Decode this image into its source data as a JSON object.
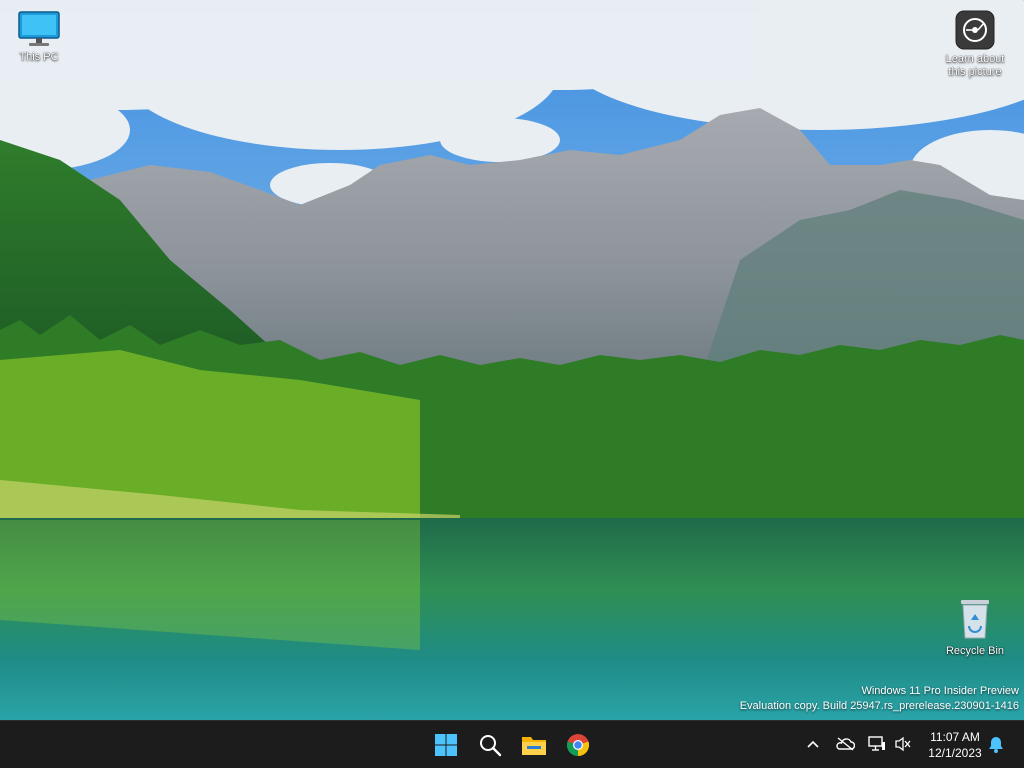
{
  "desktop": {
    "wallpaper": "mountain-lake-forest",
    "icons": {
      "this_pc": {
        "label": "This PC",
        "icon": "monitor-icon"
      },
      "learn": {
        "label_line1": "Learn about",
        "label_line2": "this picture",
        "icon": "camera-info-icon"
      },
      "recycle_bin": {
        "label": "Recycle Bin",
        "icon": "recycle-bin-icon"
      }
    },
    "watermark": {
      "line1": "Windows 11 Pro Insider Preview",
      "line2": "Evaluation copy. Build 25947.rs_prerelease.230901-1416"
    }
  },
  "taskbar": {
    "apps": [
      "windows-start-icon",
      "search-icon",
      "file-explorer-icon",
      "chrome-icon"
    ],
    "tray": [
      "chevron-up-icon",
      "onedrive-offline-icon",
      "network-icon",
      "volume-muted-icon"
    ],
    "clock": {
      "time": "11:07 AM",
      "date": "12/1/2023"
    },
    "notification": "bell-icon"
  },
  "colors": {
    "taskbar_bg": "#1c1c1c",
    "accent": "#0078d4",
    "text": "#ffffff"
  }
}
